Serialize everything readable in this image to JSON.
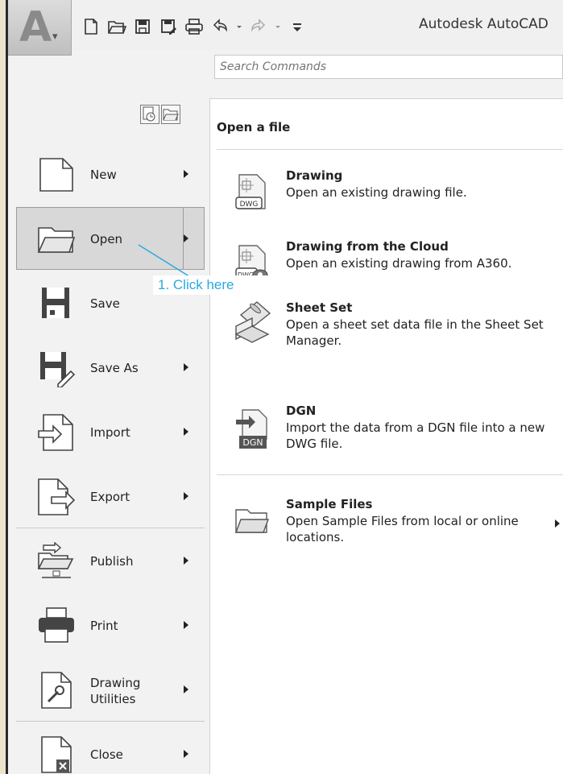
{
  "app": {
    "logo_letter": "A",
    "title": "Autodesk AutoCAD"
  },
  "search": {
    "placeholder": "Search Commands"
  },
  "menu": {
    "items": [
      {
        "label": "New"
      },
      {
        "label": "Open"
      },
      {
        "label": "Save"
      },
      {
        "label": "Save As"
      },
      {
        "label": "Import"
      },
      {
        "label": "Export"
      },
      {
        "label": "Publish"
      },
      {
        "label": "Print"
      },
      {
        "label_line1": "Drawing",
        "label_line2": "Utilities"
      },
      {
        "label": "Close"
      }
    ]
  },
  "panel": {
    "heading": "Open a file",
    "items": [
      {
        "title": "Drawing",
        "desc": "Open an existing drawing file.",
        "icon": "dwg-file-icon",
        "icon_text": "DWG"
      },
      {
        "title": "Drawing from the Cloud",
        "desc": "Open an existing drawing from A360.",
        "icon": "cloud-dwg-icon",
        "icon_text": "DWG"
      },
      {
        "title": "Sheet Set",
        "desc": "Open a sheet set data file in the Sheet Set Manager.",
        "icon": "sheet-set-icon"
      },
      {
        "title": "DGN",
        "desc": "Import the data from a DGN file into a new DWG file.",
        "icon": "dgn-import-icon",
        "icon_text": "DGN"
      },
      {
        "title": "Sample Files",
        "desc": "Open Sample Files from local or online locations.",
        "icon": "folder-icon"
      }
    ]
  },
  "annotation": {
    "text": "1. Click here",
    "color": "#29a9e1"
  }
}
